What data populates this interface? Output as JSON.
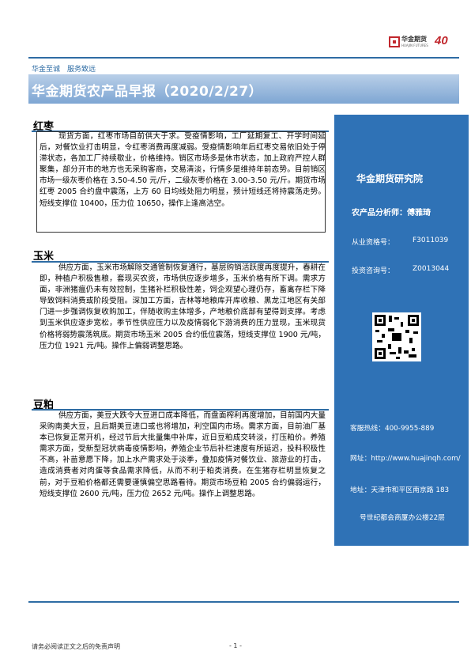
{
  "header": {
    "logo_text": "华金期货",
    "logo_sub": "HUAJIN FUTURES",
    "logo_badge": "40",
    "slogan": "华金至诚　服务致远",
    "title": "华金期货农产品早报（2020/2/27）"
  },
  "sections": [
    {
      "title": "红枣",
      "body": "现货方面，红枣市场目前供大于求。受疫情影响，工厂延期复工、开学时间延后，对餐饮业打击明显，令红枣消费再度减弱。受疫情影响年后红枣交易依旧处于停滞状态，各加工厂持续歇业，价格维持。销区市场多是休市状态，加上政府严控人群聚集，部分开市的地方也无采购客商，交易清淡，行情多是维持年前态势。目前销区市场一级灰枣价格在 3.50-4.50 元/斤，二级灰枣价格在 3.00-3.50 元/斤。期货市场红枣 2005 合约盘中震荡，上方 60 日均线处阻力明显，预计短线还将持震荡走势。短线支撑位 10400，压力位 10650，操作上逢高沽空。"
    },
    {
      "title": "玉米",
      "body": "供应方面，玉米市场解除交通管制恢复通行，基层购销活跃度再度提升，春耕在即，种植户积极售粮，套现买农资，市场供应逐步增多，玉米价格有所下调。需求方面，非洲猪瘟仍未有效控制，生猪补栏积极性差，饲企观望心理仍存，畜禽存栏下降导致饲料消费或阶段受阻。深加工方面，吉林等地粮库开库收粮、黑龙江地区有关部门进一步强调恢复收购加工，伴随收购主体增多，产地粮价底部有望得到支撑。考虑到玉米供应逐步宽松，季节性供应压力以及疫情弱化下游消费的压力显现，玉米现货价格将弱势震荡筑底。期货市场玉米 2005 合约低位震荡，短线支撑位 1900 元/吨，压力位 1921 元/吨。操作上偏弱调整思路。"
    },
    {
      "title": "豆粕",
      "body": "供应方面，美豆大跌令大豆进口成本降低，而盘面榨利再度增加，目前国内大量采购南美大豆，且后期美豆进口或也将增加，利空国内市场。需求方面，目前油厂基本已恢复正常开机，经过节后大批量集中补库，近日豆粕成交转淡，打压粕价。养殖需求方面，受新型冠状病毒疫情影响，养殖企业节后补栏速度有所延迟，投料积极性不高，补苗意愿下降，加上水产需求处于淡季，叠加疫情对餐饮业、旅游业的打击，造成消费者对肉蛋等食品需求降低，从而不利于粕类消费。在生猪存栏明显恢复之前，对于豆粕价格都还需要谨慎偏空思路看待。期货市场豆粕 2005 合约偏弱运行，短线支撑位 2600 元/吨，压力位 2652 元/吨。操作上调整思路。"
    }
  ],
  "sidebar": {
    "institute": "华金期货研究院",
    "analyst": "农产品分析师：傅雅琦",
    "license_label": "从业资格号：",
    "license_value": "F3011039",
    "consult_label": "投资咨询号：",
    "consult_value": "Z0013044",
    "hotline": "客服热线：400-9955-889",
    "website": "网址：http://www.huajinqh.com/",
    "address_1": "地址：天津市和平区南京路 183",
    "address_2": "号世纪都会商厦办公楼22层"
  },
  "footer": {
    "disclaimer": "请务必阅读正文之后的免责声明",
    "page": "- 1 -"
  }
}
